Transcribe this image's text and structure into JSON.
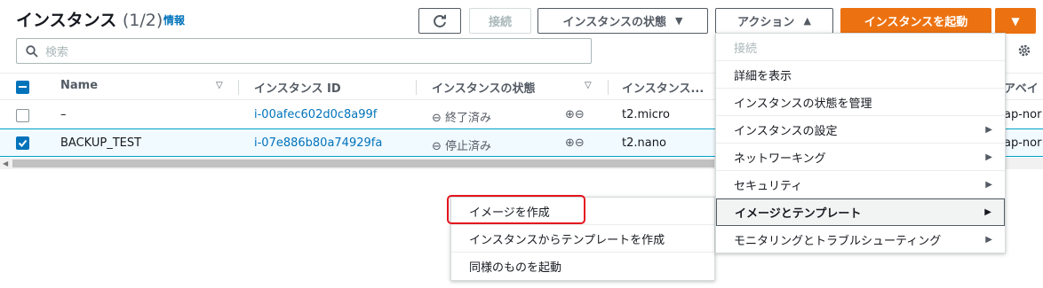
{
  "header": {
    "title": "インスタンス",
    "count": "(1/2)",
    "info_link": "情報"
  },
  "toolbar": {
    "connect_label": "接続",
    "instance_state_label": "インスタンスの状態",
    "actions_label": "アクション",
    "launch_label": "インスタンスを起動"
  },
  "search": {
    "placeholder": "検索"
  },
  "table": {
    "columns": [
      "Name",
      "インスタンス ID",
      "インスタンスの状態",
      "インスタンス...",
      "アベイ"
    ],
    "rows": [
      {
        "name": "–",
        "id": "i-00afec602d0c8a99f",
        "state": "終了済み",
        "type": "t2.micro",
        "az": "ap-nor",
        "selected": false
      },
      {
        "name": "BACKUP_TEST",
        "id": "i-07e886b80a74929fa",
        "state": "停止済み",
        "type": "t2.nano",
        "az": "ap-nor",
        "selected": true
      }
    ]
  },
  "actions_menu": {
    "items": [
      {
        "label": "接続"
      },
      {
        "label": "詳細を表示"
      },
      {
        "label": "インスタンスの状態を管理"
      },
      {
        "label": "インスタンスの設定"
      },
      {
        "label": "ネットワーキング"
      },
      {
        "label": "セキュリティ"
      },
      {
        "label": "イメージとテンプレート"
      },
      {
        "label": "モニタリングとトラブルシューティング"
      }
    ]
  },
  "submenu": {
    "items": [
      {
        "label": "イメージを作成"
      },
      {
        "label": "インスタンスからテンプレートを作成"
      },
      {
        "label": "同様のものを起動"
      }
    ]
  },
  "colors": {
    "primary": "#ec7211",
    "link": "#0073bb",
    "highlight": "#e4141e"
  }
}
